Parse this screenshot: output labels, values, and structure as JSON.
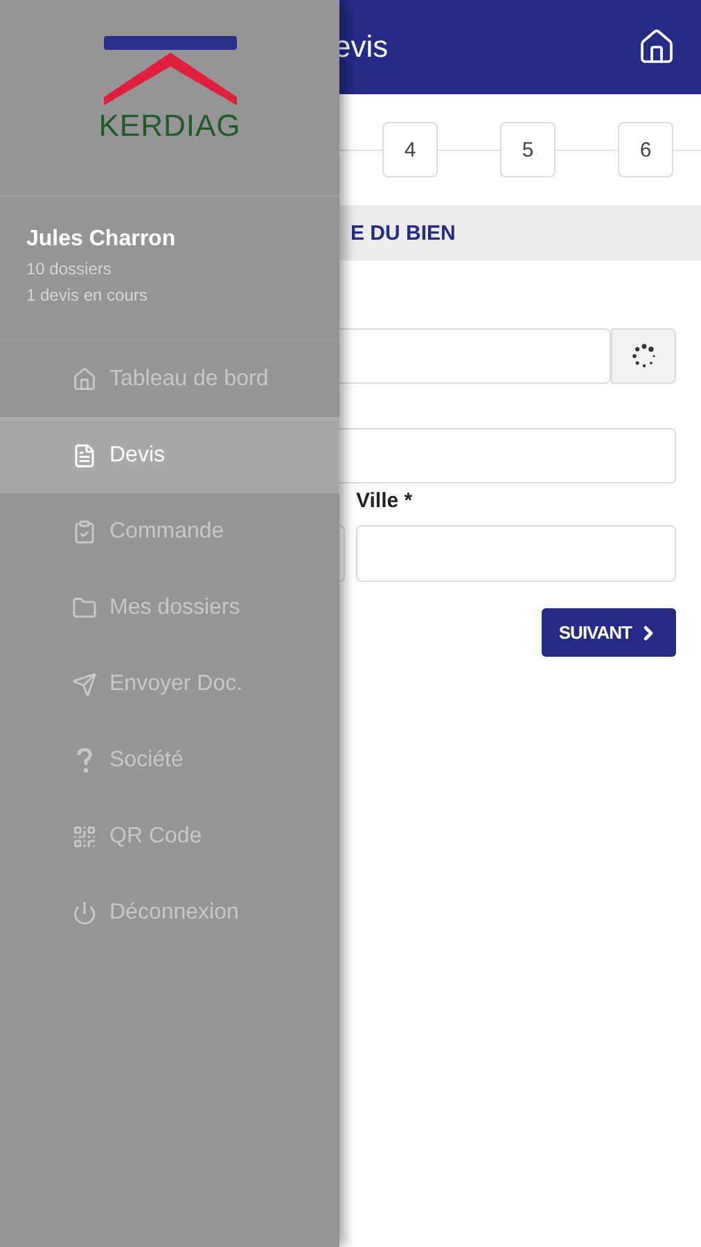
{
  "drawer": {
    "logo_text": "KERDIAG",
    "user": {
      "name": "Jules Charron",
      "lines": [
        "10 dossiers",
        "1 devis en cours"
      ]
    },
    "menu": [
      {
        "label": "Tableau de bord",
        "selected": false
      },
      {
        "label": "Devis",
        "selected": true
      },
      {
        "label": "Commande",
        "selected": false
      },
      {
        "label": "Mes dossiers",
        "selected": false
      },
      {
        "label": "Envoyer Doc.",
        "selected": false
      },
      {
        "label": "Société",
        "selected": false
      },
      {
        "label": "QR Code",
        "selected": false
      },
      {
        "label": "Déconnexion",
        "selected": false
      }
    ]
  },
  "header": {
    "title": "evis"
  },
  "steps": [
    "4",
    "5",
    "6"
  ],
  "section": {
    "title": "E DU BIEN"
  },
  "form": {
    "city_label": "Ville *"
  },
  "next_button": "SUIVANT"
}
